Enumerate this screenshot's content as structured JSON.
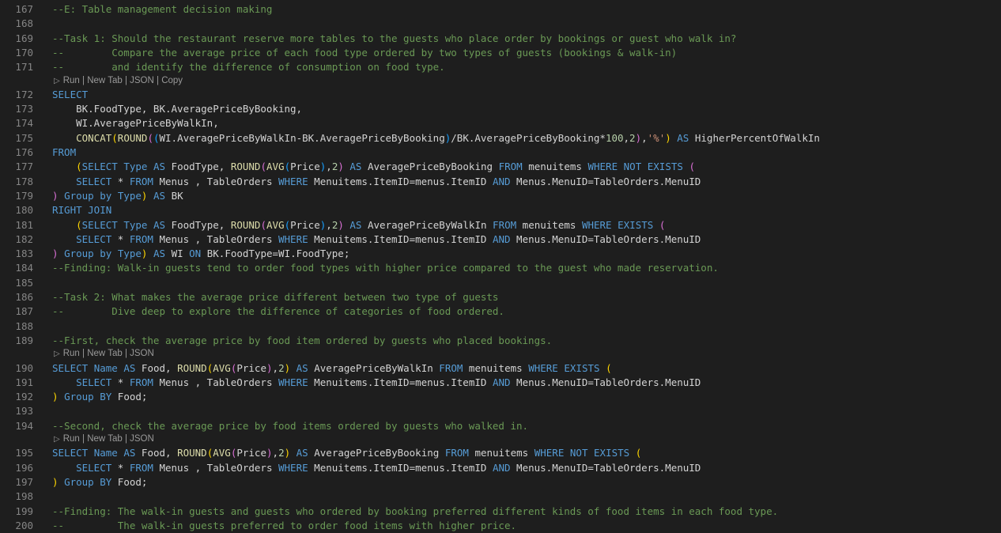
{
  "colors": {
    "background": "#1e1e1e",
    "line_number": "#858585",
    "comment": "#6a9955",
    "keyword": "#569cd6",
    "function": "#dcdcaa",
    "number": "#b5cea8",
    "string": "#ce9178",
    "bracket_level1": "#ffd700",
    "bracket_level2": "#da70d6",
    "bracket_level3": "#179fff",
    "codelens": "#999999"
  },
  "codelens": {
    "run": "Run",
    "sep": "|",
    "new_tab": "New Tab",
    "json": "JSON",
    "copy": "Copy",
    "icon": "run-triangle-icon"
  },
  "editor": {
    "lines": [
      {
        "n": "167",
        "tokens": [
          [
            "c",
            "--E: Table management decision making"
          ]
        ]
      },
      {
        "n": "168",
        "tokens": []
      },
      {
        "n": "169",
        "tokens": [
          [
            "c",
            "--Task 1: Should the restaurant reserve more tables to the guests who place order by bookings or guest who walk in?"
          ]
        ]
      },
      {
        "n": "170",
        "tokens": [
          [
            "c",
            "--        Compare the average price of each food type ordered by two types of guests (bookings & walk-in)"
          ]
        ]
      },
      {
        "n": "171",
        "tokens": [
          [
            "c",
            "--        and identify the difference of consumption on food type."
          ]
        ],
        "lens": "full"
      },
      {
        "n": "172",
        "tokens": [
          [
            "k",
            "SELECT"
          ]
        ]
      },
      {
        "n": "173",
        "tokens": [
          [
            "t",
            "    BK.FoodType, BK.AveragePriceByBooking,"
          ]
        ]
      },
      {
        "n": "174",
        "tokens": [
          [
            "t",
            "    WI.AveragePriceByWalkIn,"
          ]
        ]
      },
      {
        "n": "175",
        "tokens": [
          [
            "t",
            "    "
          ],
          [
            "f",
            "CONCAT"
          ],
          [
            "b1",
            "("
          ],
          [
            "f",
            "ROUND"
          ],
          [
            "b2",
            "("
          ],
          [
            "b3",
            "("
          ],
          [
            "t",
            "WI.AveragePriceByWalkIn-BK.AveragePriceByBooking"
          ],
          [
            "b3",
            ")"
          ],
          [
            "t",
            "/BK.AveragePriceByBooking*"
          ],
          [
            "n",
            "100"
          ],
          [
            "t",
            ","
          ],
          [
            "n",
            "2"
          ],
          [
            "b2",
            ")"
          ],
          [
            "t",
            ","
          ],
          [
            "s",
            "'%'"
          ],
          [
            "b1",
            ")"
          ],
          [
            "t",
            " "
          ],
          [
            "k",
            "AS"
          ],
          [
            "t",
            " HigherPercentOfWalkIn"
          ]
        ]
      },
      {
        "n": "176",
        "tokens": [
          [
            "k",
            "FROM"
          ]
        ]
      },
      {
        "n": "177",
        "tokens": [
          [
            "t",
            "    "
          ],
          [
            "b1",
            "("
          ],
          [
            "k",
            "SELECT"
          ],
          [
            "t",
            " "
          ],
          [
            "k",
            "Type"
          ],
          [
            "t",
            " "
          ],
          [
            "k",
            "AS"
          ],
          [
            "t",
            " FoodType, "
          ],
          [
            "f",
            "ROUND"
          ],
          [
            "b2",
            "("
          ],
          [
            "f",
            "AVG"
          ],
          [
            "b3",
            "("
          ],
          [
            "t",
            "Price"
          ],
          [
            "b3",
            ")"
          ],
          [
            "t",
            ","
          ],
          [
            "n",
            "2"
          ],
          [
            "b2",
            ")"
          ],
          [
            "t",
            " "
          ],
          [
            "k",
            "AS"
          ],
          [
            "t",
            " AveragePriceByBooking "
          ],
          [
            "k",
            "FROM"
          ],
          [
            "t",
            " menuitems "
          ],
          [
            "k",
            "WHERE"
          ],
          [
            "t",
            " "
          ],
          [
            "k",
            "NOT"
          ],
          [
            "t",
            " "
          ],
          [
            "k",
            "EXISTS"
          ],
          [
            "t",
            " "
          ],
          [
            "b2",
            "("
          ]
        ]
      },
      {
        "n": "178",
        "tokens": [
          [
            "t",
            "    "
          ],
          [
            "k",
            "SELECT"
          ],
          [
            "t",
            " * "
          ],
          [
            "k",
            "FROM"
          ],
          [
            "t",
            " Menus , TableOrders "
          ],
          [
            "k",
            "WHERE"
          ],
          [
            "t",
            " Menuitems.ItemID=menus.ItemID "
          ],
          [
            "k",
            "AND"
          ],
          [
            "t",
            " Menus.MenuID=TableOrders.MenuID"
          ]
        ]
      },
      {
        "n": "179",
        "tokens": [
          [
            "b2",
            ")"
          ],
          [
            "t",
            " "
          ],
          [
            "k",
            "Group by"
          ],
          [
            "t",
            " "
          ],
          [
            "k",
            "Type"
          ],
          [
            "b1",
            ")"
          ],
          [
            "t",
            " "
          ],
          [
            "k",
            "AS"
          ],
          [
            "t",
            " BK"
          ]
        ]
      },
      {
        "n": "180",
        "tokens": [
          [
            "k",
            "RIGHT JOIN"
          ]
        ]
      },
      {
        "n": "181",
        "tokens": [
          [
            "t",
            "    "
          ],
          [
            "b1",
            "("
          ],
          [
            "k",
            "SELECT"
          ],
          [
            "t",
            " "
          ],
          [
            "k",
            "Type"
          ],
          [
            "t",
            " "
          ],
          [
            "k",
            "AS"
          ],
          [
            "t",
            " FoodType, "
          ],
          [
            "f",
            "ROUND"
          ],
          [
            "b2",
            "("
          ],
          [
            "f",
            "AVG"
          ],
          [
            "b3",
            "("
          ],
          [
            "t",
            "Price"
          ],
          [
            "b3",
            ")"
          ],
          [
            "t",
            ","
          ],
          [
            "n",
            "2"
          ],
          [
            "b2",
            ")"
          ],
          [
            "t",
            " "
          ],
          [
            "k",
            "AS"
          ],
          [
            "t",
            " AveragePriceByWalkIn "
          ],
          [
            "k",
            "FROM"
          ],
          [
            "t",
            " menuitems "
          ],
          [
            "k",
            "WHERE"
          ],
          [
            "t",
            " "
          ],
          [
            "k",
            "EXISTS"
          ],
          [
            "t",
            " "
          ],
          [
            "b2",
            "("
          ]
        ]
      },
      {
        "n": "182",
        "tokens": [
          [
            "t",
            "    "
          ],
          [
            "k",
            "SELECT"
          ],
          [
            "t",
            " * "
          ],
          [
            "k",
            "FROM"
          ],
          [
            "t",
            " Menus , TableOrders "
          ],
          [
            "k",
            "WHERE"
          ],
          [
            "t",
            " Menuitems.ItemID=menus.ItemID "
          ],
          [
            "k",
            "AND"
          ],
          [
            "t",
            " Menus.MenuID=TableOrders.MenuID"
          ]
        ]
      },
      {
        "n": "183",
        "tokens": [
          [
            "b2",
            ")"
          ],
          [
            "t",
            " "
          ],
          [
            "k",
            "Group by"
          ],
          [
            "t",
            " "
          ],
          [
            "k",
            "Type"
          ],
          [
            "b1",
            ")"
          ],
          [
            "t",
            " "
          ],
          [
            "k",
            "AS"
          ],
          [
            "t",
            " WI "
          ],
          [
            "k",
            "ON"
          ],
          [
            "t",
            " BK.FoodType=WI.FoodType;"
          ]
        ]
      },
      {
        "n": "184",
        "tokens": [
          [
            "c",
            "--Finding: Walk-in guests tend to order food types with higher price compared to the guest who made reservation."
          ]
        ]
      },
      {
        "n": "185",
        "tokens": []
      },
      {
        "n": "186",
        "tokens": [
          [
            "c",
            "--Task 2: What makes the average price different between two type of guests"
          ]
        ]
      },
      {
        "n": "187",
        "tokens": [
          [
            "c",
            "--        Dive deep to explore the difference of categories of food ordered."
          ]
        ]
      },
      {
        "n": "188",
        "tokens": []
      },
      {
        "n": "189",
        "tokens": [
          [
            "c",
            "--First, check the average price by food item ordered by guests who placed bookings."
          ]
        ],
        "lens": "short"
      },
      {
        "n": "190",
        "tokens": [
          [
            "k",
            "SELECT"
          ],
          [
            "t",
            " "
          ],
          [
            "k",
            "Name"
          ],
          [
            "t",
            " "
          ],
          [
            "k",
            "AS"
          ],
          [
            "t",
            " Food, "
          ],
          [
            "f",
            "ROUND"
          ],
          [
            "b1",
            "("
          ],
          [
            "f",
            "AVG"
          ],
          [
            "b2",
            "("
          ],
          [
            "t",
            "Price"
          ],
          [
            "b2",
            ")"
          ],
          [
            "t",
            ","
          ],
          [
            "n",
            "2"
          ],
          [
            "b1",
            ")"
          ],
          [
            "t",
            " "
          ],
          [
            "k",
            "AS"
          ],
          [
            "t",
            " AveragePriceByWalkIn "
          ],
          [
            "k",
            "FROM"
          ],
          [
            "t",
            " menuitems "
          ],
          [
            "k",
            "WHERE"
          ],
          [
            "t",
            " "
          ],
          [
            "k",
            "EXISTS"
          ],
          [
            "t",
            " "
          ],
          [
            "b1",
            "("
          ]
        ]
      },
      {
        "n": "191",
        "tokens": [
          [
            "t",
            "    "
          ],
          [
            "k",
            "SELECT"
          ],
          [
            "t",
            " * "
          ],
          [
            "k",
            "FROM"
          ],
          [
            "t",
            " Menus , TableOrders "
          ],
          [
            "k",
            "WHERE"
          ],
          [
            "t",
            " Menuitems.ItemID=menus.ItemID "
          ],
          [
            "k",
            "AND"
          ],
          [
            "t",
            " Menus.MenuID=TableOrders.MenuID"
          ]
        ]
      },
      {
        "n": "192",
        "tokens": [
          [
            "b1",
            ")"
          ],
          [
            "t",
            " "
          ],
          [
            "k",
            "Group BY"
          ],
          [
            "t",
            " Food;"
          ]
        ]
      },
      {
        "n": "193",
        "tokens": []
      },
      {
        "n": "194",
        "tokens": [
          [
            "c",
            "--Second, check the average price by food items ordered by guests who walked in."
          ]
        ],
        "lens": "short"
      },
      {
        "n": "195",
        "tokens": [
          [
            "k",
            "SELECT"
          ],
          [
            "t",
            " "
          ],
          [
            "k",
            "Name"
          ],
          [
            "t",
            " "
          ],
          [
            "k",
            "AS"
          ],
          [
            "t",
            " Food, "
          ],
          [
            "f",
            "ROUND"
          ],
          [
            "b1",
            "("
          ],
          [
            "f",
            "AVG"
          ],
          [
            "b2",
            "("
          ],
          [
            "t",
            "Price"
          ],
          [
            "b2",
            ")"
          ],
          [
            "t",
            ","
          ],
          [
            "n",
            "2"
          ],
          [
            "b1",
            ")"
          ],
          [
            "t",
            " "
          ],
          [
            "k",
            "AS"
          ],
          [
            "t",
            " AveragePriceByBooking "
          ],
          [
            "k",
            "FROM"
          ],
          [
            "t",
            " menuitems "
          ],
          [
            "k",
            "WHERE"
          ],
          [
            "t",
            " "
          ],
          [
            "k",
            "NOT"
          ],
          [
            "t",
            " "
          ],
          [
            "k",
            "EXISTS"
          ],
          [
            "t",
            " "
          ],
          [
            "b1",
            "("
          ]
        ]
      },
      {
        "n": "196",
        "tokens": [
          [
            "t",
            "    "
          ],
          [
            "k",
            "SELECT"
          ],
          [
            "t",
            " * "
          ],
          [
            "k",
            "FROM"
          ],
          [
            "t",
            " Menus , TableOrders "
          ],
          [
            "k",
            "WHERE"
          ],
          [
            "t",
            " Menuitems.ItemID=menus.ItemID "
          ],
          [
            "k",
            "AND"
          ],
          [
            "t",
            " Menus.MenuID=TableOrders.MenuID"
          ]
        ]
      },
      {
        "n": "197",
        "tokens": [
          [
            "b1",
            ")"
          ],
          [
            "t",
            " "
          ],
          [
            "k",
            "Group BY"
          ],
          [
            "t",
            " Food;"
          ]
        ]
      },
      {
        "n": "198",
        "tokens": []
      },
      {
        "n": "199",
        "tokens": [
          [
            "c",
            "--Finding: The walk-in guests and guests who ordered by booking preferred different kinds of food items in each food type."
          ]
        ]
      },
      {
        "n": "200",
        "tokens": [
          [
            "c",
            "--         The walk-in guests preferred to order food items with higher price."
          ]
        ]
      }
    ]
  }
}
